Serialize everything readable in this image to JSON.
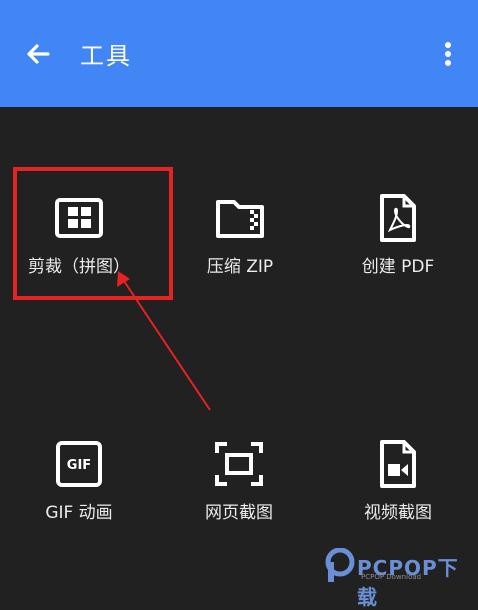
{
  "appbar": {
    "title": "工具"
  },
  "tools": [
    {
      "label": "剪裁（拼图）"
    },
    {
      "label": "压缩 ZIP"
    },
    {
      "label": "创建 PDF"
    },
    {
      "label": "GIF 动画"
    },
    {
      "label": "网页截图"
    },
    {
      "label": "视频截图"
    }
  ],
  "annotation": {
    "highlight_color": "#e52323"
  },
  "colors": {
    "appbar": "#4285f4",
    "background": "#212121"
  },
  "watermark": {
    "brand": "PCPOP下载",
    "sub": "PCPOP Download"
  }
}
